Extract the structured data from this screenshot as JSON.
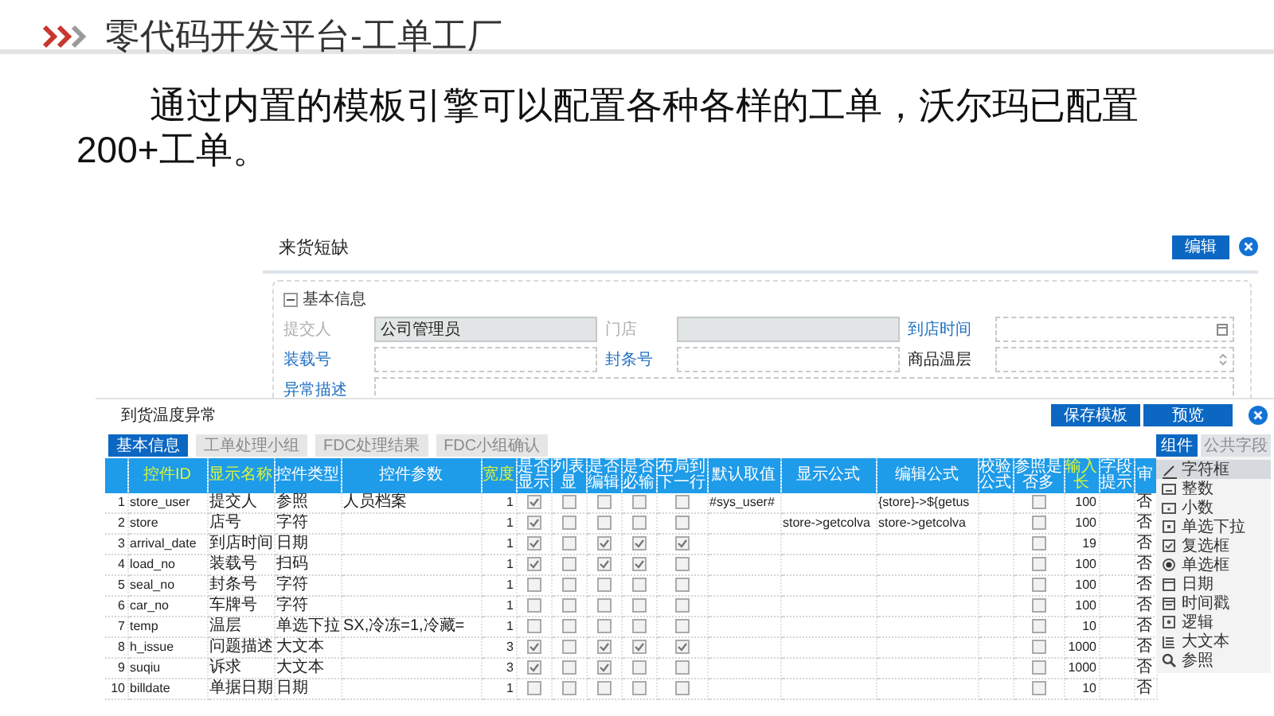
{
  "slide": {
    "title": "零代码开发平台-工单工厂",
    "paragraph": "通过内置的模板引擎可以配置各种各样的工单，沃尔玛已配置200+工单。"
  },
  "form_window": {
    "title": "来货短缺",
    "edit_button": "编辑",
    "section": {
      "title": "基本信息",
      "expanded": true
    },
    "fields": [
      {
        "label": "提交人",
        "required": false,
        "kind": "text",
        "value": "公司管理员",
        "disabled": true
      },
      {
        "label": "门店",
        "required": false,
        "kind": "text",
        "disabled": true
      },
      {
        "label": "到店时间",
        "required": true,
        "kind": "date",
        "disabled": false
      },
      {
        "label": "装载号",
        "required": true,
        "kind": "text",
        "disabled": false
      },
      {
        "label": "封条号",
        "required": true,
        "kind": "text",
        "disabled": false
      },
      {
        "label": "商品温层",
        "required": false,
        "kind": "select",
        "disabled": false
      },
      {
        "label": "异常描述",
        "required": true,
        "kind": "textarea",
        "disabled": false
      }
    ]
  },
  "designer_window": {
    "title": "到货温度异常",
    "buttons": [
      "保存模板",
      "预览"
    ],
    "tabs": [
      {
        "label": "基本信息",
        "selected": true
      },
      {
        "label": "工单处理小组",
        "selected": false
      },
      {
        "label": "FDC处理结果",
        "selected": false
      },
      {
        "label": "FDC小组确认",
        "selected": false
      }
    ],
    "table": {
      "columns": [
        {
          "kind": "rownum"
        },
        {
          "label": "控件ID",
          "kind": "code",
          "highlight": true
        },
        {
          "label": "显示名称",
          "kind": "text",
          "highlight": true
        },
        {
          "label": "控件类型",
          "kind": "text",
          "highlight": false
        },
        {
          "label": "控件参数",
          "kind": "text",
          "highlight": false
        },
        {
          "label": "宽度",
          "kind": "number",
          "highlight": true
        },
        {
          "label": "是否显示",
          "kind": "check",
          "highlight": false
        },
        {
          "label": "列表显",
          "kind": "check",
          "highlight": false
        },
        {
          "label": "是否编辑",
          "kind": "check",
          "highlight": false
        },
        {
          "label": "是否必输",
          "kind": "check",
          "highlight": false
        },
        {
          "label": "布局到下一行",
          "kind": "check",
          "highlight": false
        },
        {
          "label": "默认取值",
          "kind": "code",
          "highlight": false
        },
        {
          "label": "显示公式",
          "kind": "code",
          "highlight": false
        },
        {
          "label": "编辑公式",
          "kind": "code",
          "highlight": false
        },
        {
          "label": "校验公式",
          "kind": "code",
          "highlight": false
        },
        {
          "label": "参照是否多",
          "kind": "check",
          "highlight": false
        },
        {
          "label": "输入长",
          "kind": "number",
          "highlight": true
        },
        {
          "label": "字段提示",
          "kind": "text",
          "highlight": false
        },
        {
          "label": "审",
          "kind": "text",
          "highlight": false
        }
      ],
      "rows": [
        {
          "cells": [
            "1",
            "store_user",
            "提交人",
            "参照",
            "人员档案",
            "1",
            {
              "checked": true
            },
            {
              "checked": false
            },
            {
              "checked": false
            },
            {
              "checked": false
            },
            {
              "checked": false
            },
            "#sys_user#",
            null,
            "{store}->${getus",
            null,
            {
              "checked": false
            },
            "100",
            null,
            "否"
          ]
        },
        {
          "cells": [
            "2",
            "store",
            "店号",
            "字符",
            null,
            "1",
            {
              "checked": true
            },
            {
              "checked": false
            },
            {
              "checked": false
            },
            {
              "checked": false
            },
            {
              "checked": false
            },
            null,
            "store->getcolva",
            "store->getcolva",
            null,
            {
              "checked": false
            },
            "100",
            null,
            "否"
          ]
        },
        {
          "cells": [
            "3",
            "arrival_date",
            "到店时间",
            "日期",
            null,
            "1",
            {
              "checked": true
            },
            {
              "checked": false
            },
            {
              "checked": true
            },
            {
              "checked": true
            },
            {
              "checked": true
            },
            null,
            null,
            null,
            null,
            {
              "checked": false
            },
            "19",
            null,
            "否"
          ]
        },
        {
          "cells": [
            "4",
            "load_no",
            "装载号",
            "扫码",
            null,
            "1",
            {
              "checked": true
            },
            {
              "checked": false
            },
            {
              "checked": true
            },
            {
              "checked": true
            },
            {
              "checked": false
            },
            null,
            null,
            null,
            null,
            {
              "checked": false
            },
            "100",
            null,
            "否"
          ]
        },
        {
          "cells": [
            "5",
            "seal_no",
            "封条号",
            "字符",
            null,
            "1",
            {
              "checked": false
            },
            {
              "checked": false
            },
            {
              "checked": false
            },
            {
              "checked": false
            },
            {
              "checked": false
            },
            null,
            null,
            null,
            null,
            {
              "checked": false
            },
            "100",
            null,
            "否"
          ]
        },
        {
          "cells": [
            "6",
            "car_no",
            "车牌号",
            "字符",
            null,
            "1",
            {
              "checked": false
            },
            {
              "checked": false
            },
            {
              "checked": false
            },
            {
              "checked": false
            },
            {
              "checked": false
            },
            null,
            null,
            null,
            null,
            {
              "checked": false
            },
            "100",
            null,
            "否"
          ]
        },
        {
          "cells": [
            "7",
            "temp",
            "温层",
            "单选下拉",
            "SX,冷冻=1,冷藏=",
            "1",
            {
              "checked": false
            },
            {
              "checked": false
            },
            {
              "checked": false
            },
            {
              "checked": false
            },
            {
              "checked": false
            },
            null,
            null,
            null,
            null,
            {
              "checked": false
            },
            "10",
            null,
            "否"
          ]
        },
        {
          "cells": [
            "8",
            "h_issue",
            "问题描述",
            "大文本",
            null,
            "3",
            {
              "checked": true
            },
            {
              "checked": false
            },
            {
              "checked": true
            },
            {
              "checked": true
            },
            {
              "checked": true
            },
            null,
            null,
            null,
            null,
            {
              "checked": false
            },
            "1000",
            null,
            "否"
          ]
        },
        {
          "cells": [
            "9",
            "suqiu",
            "诉求",
            "大文本",
            null,
            "3",
            {
              "checked": true
            },
            {
              "checked": false
            },
            {
              "checked": true
            },
            {
              "checked": false
            },
            {
              "checked": false
            },
            null,
            null,
            null,
            null,
            {
              "checked": false
            },
            "1000",
            null,
            "否"
          ]
        },
        {
          "cells": [
            "10",
            "billdate",
            "单据日期",
            "日期",
            null,
            "1",
            {
              "checked": false
            },
            {
              "checked": false
            },
            {
              "checked": false
            },
            {
              "checked": false
            },
            {
              "checked": false
            },
            null,
            null,
            null,
            null,
            {
              "checked": false
            },
            "10",
            null,
            "否"
          ]
        }
      ]
    },
    "component_panel": {
      "tabs": [
        {
          "label": "组件",
          "selected": true
        },
        {
          "label": "公共字段",
          "selected": false
        }
      ],
      "items": [
        {
          "label": "字符框",
          "kind": "text",
          "selected": true
        },
        {
          "label": "整数",
          "kind": "integer",
          "selected": false
        },
        {
          "label": "小数",
          "kind": "decimal",
          "selected": false
        },
        {
          "label": "单选下拉",
          "kind": "dropdown",
          "selected": false
        },
        {
          "label": "复选框",
          "kind": "checkbox",
          "selected": false
        },
        {
          "label": "单选框",
          "kind": "radio",
          "selected": false
        },
        {
          "label": "日期",
          "kind": "date",
          "selected": false
        },
        {
          "label": "时间戳",
          "kind": "timestamp",
          "selected": false
        },
        {
          "label": "逻辑",
          "kind": "logic",
          "selected": false
        },
        {
          "label": "大文本",
          "kind": "textarea",
          "selected": false
        },
        {
          "label": "参照",
          "kind": "reference",
          "selected": false
        }
      ]
    }
  }
}
